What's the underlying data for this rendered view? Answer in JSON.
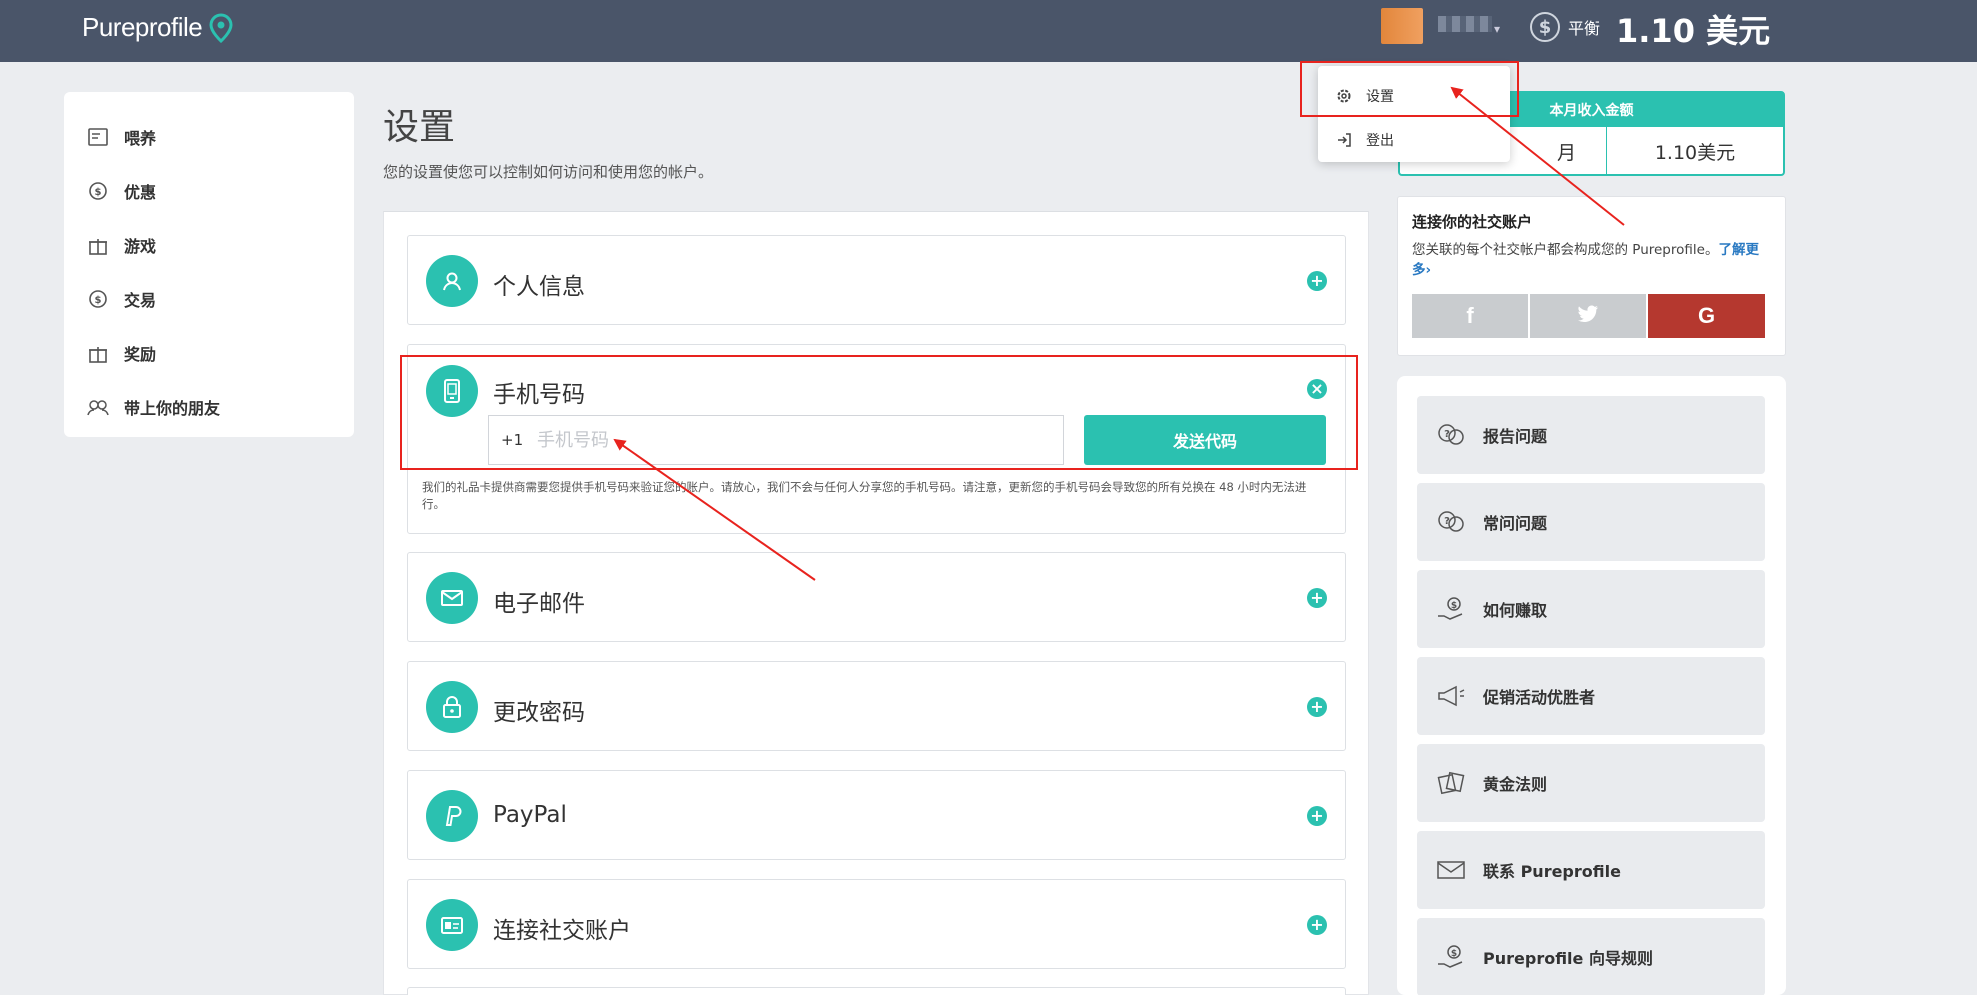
{
  "header": {
    "brand": "Pureprofile",
    "balance_label": "平衡",
    "balance_amount": "1.10 美元",
    "user_dropdown": [
      {
        "label": "设置",
        "icon": "gear-icon"
      },
      {
        "label": "登出",
        "icon": "logout-icon"
      }
    ]
  },
  "sidebar": {
    "items": [
      {
        "label": "喂养",
        "icon": "feed-icon"
      },
      {
        "label": "优惠",
        "icon": "offers-icon"
      },
      {
        "label": "游戏",
        "icon": "gift-icon"
      },
      {
        "label": "交易",
        "icon": "trade-icon"
      },
      {
        "label": "奖励",
        "icon": "gift-icon"
      },
      {
        "label": "带上你的朋友",
        "icon": "friends-icon"
      }
    ]
  },
  "main": {
    "title": "设置",
    "subtitle": "您的设置使您可以控制如何访问和使用您的帐户。",
    "sections": [
      {
        "label": "个人信息",
        "icon": "user-icon"
      },
      {
        "label": "手机号码",
        "icon": "phone-icon"
      },
      {
        "label": "电子邮件",
        "icon": "mail-icon"
      },
      {
        "label": "更改密码",
        "icon": "lock-icon"
      },
      {
        "label": "PayPal",
        "icon": "paypal-icon"
      },
      {
        "label": "连接社交账户",
        "icon": "id-card-icon"
      }
    ],
    "phone": {
      "prefix": "+1",
      "placeholder": "手机号码",
      "send_label": "发送代码",
      "note": "我们的礼品卡提供商需要您提供手机号码来验证您的账户。请放心，我们不会与任何人分享您的手机号码。请注意，更新您的手机号码会导致您的所有兑换在 48 小时内无法进行。"
    }
  },
  "right": {
    "earnings": {
      "header": "本月收入金额",
      "month": "月",
      "amount": "1.10美元"
    },
    "social": {
      "title": "连接你的社交账户",
      "text": "您关联的每个社交帐户都会构成您的 Pureprofile。",
      "link": "了解更多›",
      "buttons": [
        "f",
        "t",
        "G"
      ]
    },
    "help": [
      {
        "label": "报告问题",
        "icon": "chat-question-icon"
      },
      {
        "label": "常问问题",
        "icon": "chat-question-icon"
      },
      {
        "label": "如何赚取",
        "icon": "hand-coin-icon"
      },
      {
        "label": "促销活动优胜者",
        "icon": "megaphone-icon"
      },
      {
        "label": "黄金法则",
        "icon": "tickets-icon"
      },
      {
        "label": "联系 Pureprofile",
        "icon": "envelope-icon"
      },
      {
        "label": "Pureprofile 向导规则",
        "icon": "hand-coin-icon"
      }
    ]
  },
  "colors": {
    "accent": "#2bc1b0",
    "header": "#4a5569",
    "annotation": "#e8231e",
    "google": "#b5382f"
  }
}
